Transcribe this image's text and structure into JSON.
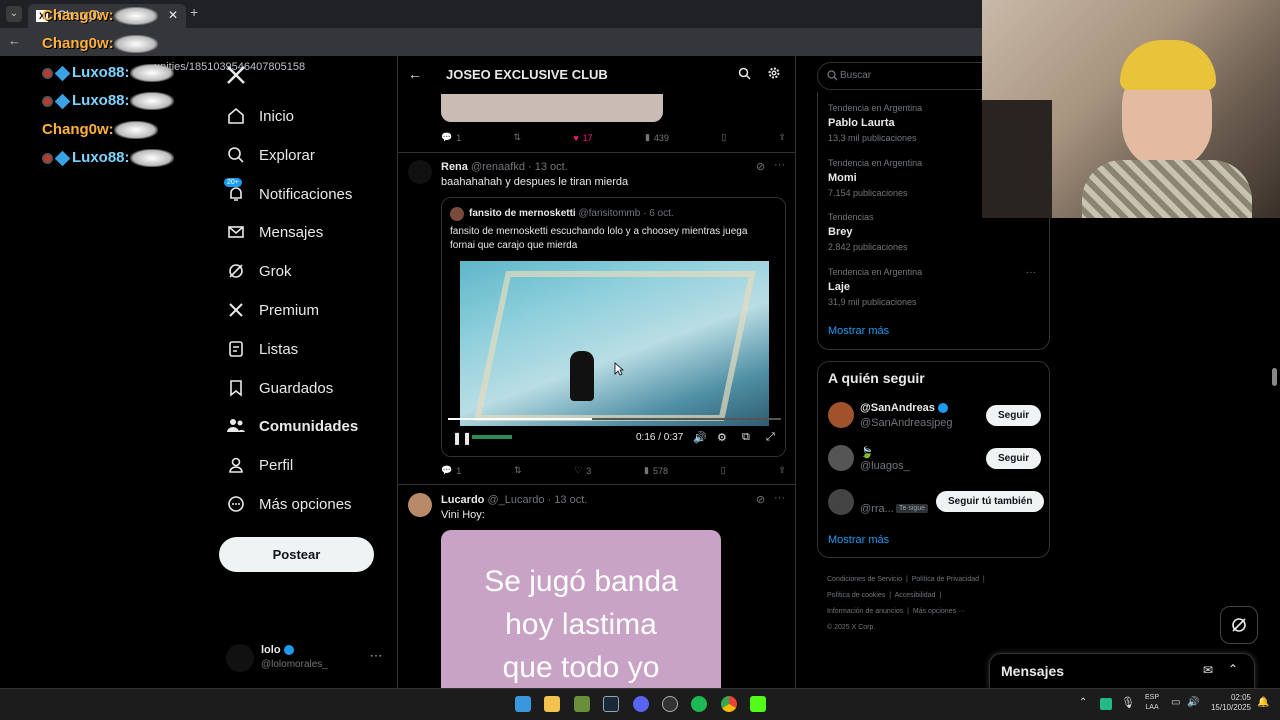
{
  "browser": {
    "tab_title": "Chang0w",
    "url": "unities/1851039546407805158"
  },
  "chat": [
    {
      "name": "Chang0w:"
    },
    {
      "name": "Chang0w:"
    },
    {
      "name": "Luxo88:"
    },
    {
      "name": "Luxo88:"
    },
    {
      "name": "Chang0w:"
    },
    {
      "name": "Luxo88:"
    }
  ],
  "nav": {
    "items": [
      {
        "label": "Inicio"
      },
      {
        "label": "Explorar"
      },
      {
        "label": "Notificaciones",
        "badge": "20+"
      },
      {
        "label": "Mensajes"
      },
      {
        "label": "Grok"
      },
      {
        "label": "Premium"
      },
      {
        "label": "Listas"
      },
      {
        "label": "Guardados"
      },
      {
        "label": "Comunidades"
      },
      {
        "label": "Perfil"
      },
      {
        "label": "Más opciones"
      }
    ],
    "post_label": "Postear",
    "account_name": "lolo",
    "account_handle": "@lolomorales_"
  },
  "header": {
    "title": "JOSEO EXCLUSIVE CLUB"
  },
  "post0": {
    "replies": "1",
    "likes": "17",
    "views": "439"
  },
  "post1": {
    "author": "Rena",
    "handle": "@renaafkd",
    "date": "· 13 oct.",
    "text": "baahahahah y despues le tiran mierda",
    "quote_author": "fansito de mernosketti",
    "quote_handle": "@fansitommb",
    "quote_date": "· 6 oct.",
    "quote_text": "fansito de mernosketti escuchando lolo y a choosey mientras juega fornai que carajo que mierda",
    "video_time": "0:16 / 0:37",
    "replies": "1",
    "likes": "3",
    "views": "578"
  },
  "post2": {
    "author": "Lucardo",
    "handle": "@_Lucardo",
    "date": "· 13 oct.",
    "text": "Vini Hoy:",
    "image_text": [
      "Se jugó banda",
      "hoy lastima",
      "que todo yo"
    ]
  },
  "search": {
    "placeholder": "Buscar"
  },
  "trends": [
    {
      "cat": "Tendencia en Argentina",
      "name": "Pablo Laurta",
      "count": "13,3 mil publicaciones"
    },
    {
      "cat": "Tendencia en Argentina",
      "name": "Momi",
      "count": "7.154 publicaciones"
    },
    {
      "cat": "Tendencias",
      "name": "Brey",
      "count": "2.842 publicaciones"
    },
    {
      "cat": "Tendencia en Argentina",
      "name": "Laje",
      "count": "31,9 mil publicaciones"
    }
  ],
  "trends_more": "Mostrar más",
  "who": {
    "title": "A quién seguir",
    "users": [
      {
        "name": "@SanAndreas",
        "handle": "@SanAndreasjpeg",
        "btn": "Seguir"
      },
      {
        "name": "",
        "handle": "@luagos_",
        "btn": "Seguir"
      },
      {
        "name": "",
        "handle": "@rra...",
        "tag": "Te sigue",
        "btn": "Seguir tú también"
      }
    ],
    "more": "Mostrar más"
  },
  "footer": {
    "links": [
      "Condiciones de Servicio",
      "Política de Privacidad",
      "Política de cookies",
      "Accesibilidad",
      "Información de anuncios",
      "Más opciones ···"
    ],
    "copyright": "© 2025 X Corp."
  },
  "messages": {
    "title": "Mensajes"
  },
  "taskbar": {
    "lang1": "ESP",
    "lang2": "LAA",
    "time": "02:05",
    "date": "15/10/2025"
  },
  "colors": {
    "accent": "#1d9bf0",
    "like": "#f91880",
    "bg": "#000000"
  }
}
